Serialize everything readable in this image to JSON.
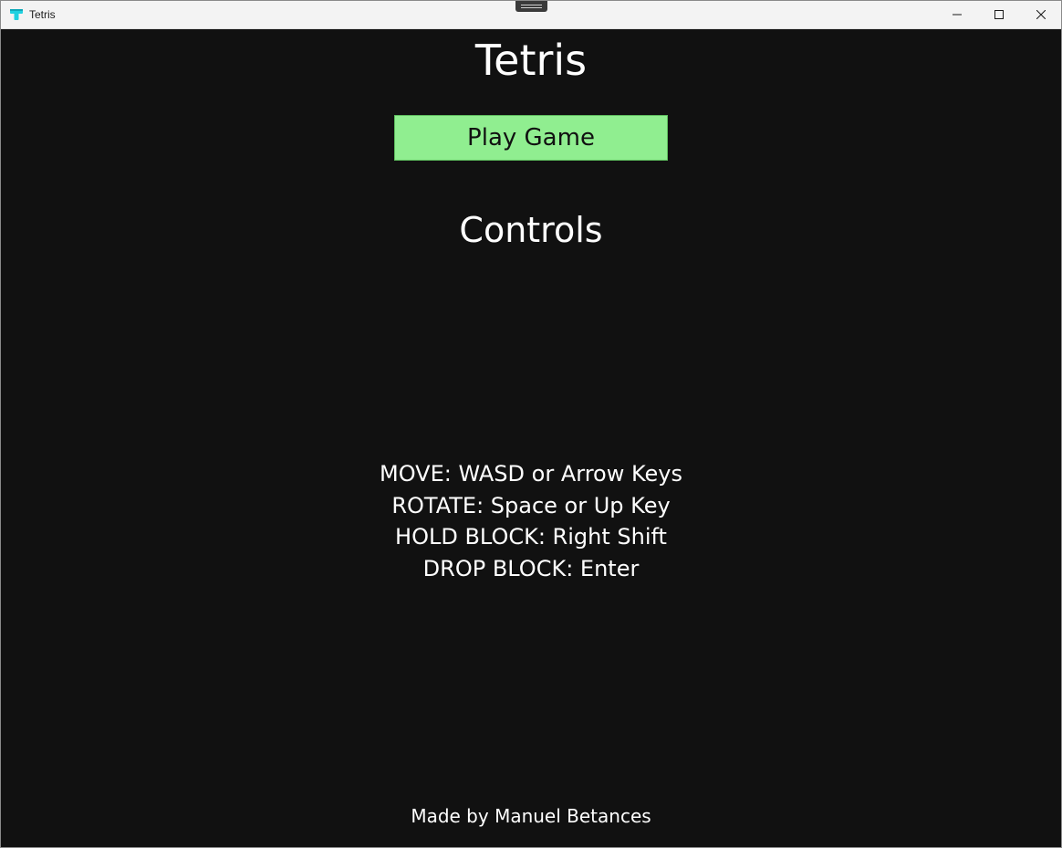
{
  "window": {
    "title": "Tetris",
    "icons": {
      "app": "tetris-app-icon",
      "minimize": "minimize-icon",
      "maximize": "maximize-icon",
      "close": "close-icon"
    }
  },
  "menu": {
    "title": "Tetris",
    "play_button": "Play Game",
    "controls_heading": "Controls",
    "controls": [
      "MOVE: WASD or Arrow Keys",
      "ROTATE: Space or Up Key",
      "HOLD BLOCK: Right Shift",
      "DROP BLOCK: Enter"
    ],
    "footer": "Made by Manuel Betances"
  },
  "colors": {
    "background": "#111111",
    "text": "#ffffff",
    "play_button": "#90ee90",
    "play_button_text": "#111111",
    "app_icon": "#1fd1e0"
  }
}
